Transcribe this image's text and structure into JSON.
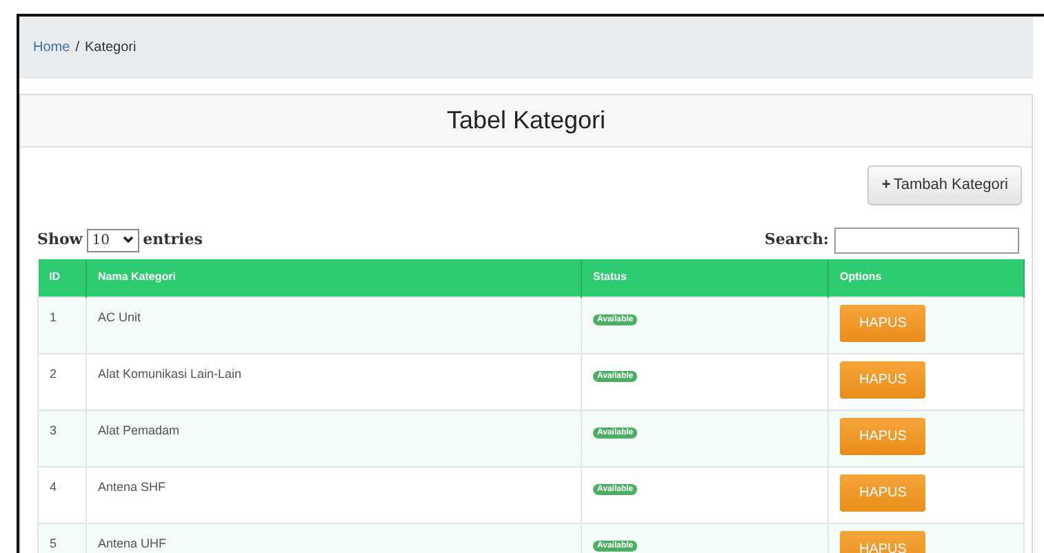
{
  "breadcrumb": [
    {
      "label": "Home",
      "link": true
    },
    {
      "label": "Kategori",
      "link": false
    }
  ],
  "breadcrumb_separator": "/",
  "card": {
    "title": "Tabel Kategori",
    "add_button": "Tambah Kategori",
    "add_icon": "+"
  },
  "length_control": {
    "prefix": "Show",
    "value": "10",
    "suffix": "entries"
  },
  "search": {
    "label": "Search:"
  },
  "table": {
    "columns": [
      "ID",
      "Nama Kategori",
      "Status",
      "Options"
    ],
    "rows": [
      {
        "id": "1",
        "name": "AC Unit",
        "status": "Available",
        "action": "HAPUS"
      },
      {
        "id": "2",
        "name": "Alat Komunikasi Lain-Lain",
        "status": "Available",
        "action": "HAPUS"
      },
      {
        "id": "3",
        "name": "Alat Pemadam",
        "status": "Available",
        "action": "HAPUS"
      },
      {
        "id": "4",
        "name": "Antena SHF",
        "status": "Available",
        "action": "HAPUS"
      },
      {
        "id": "5",
        "name": "Antena UHF",
        "status": "Available",
        "action": "HAPUS"
      }
    ]
  }
}
